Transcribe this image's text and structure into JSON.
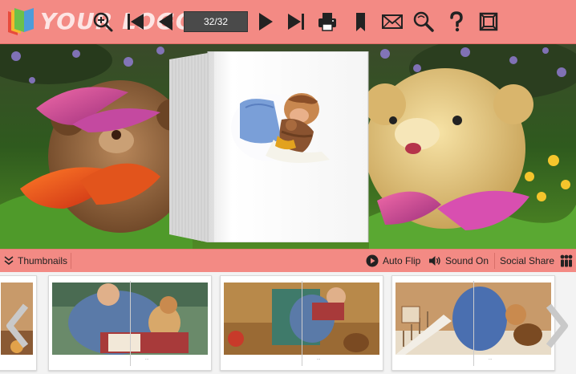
{
  "toolbar": {
    "logo_text": "YOUR LOGO",
    "page_indicator": "32/32",
    "background_color": "#f38a84",
    "buttons": [
      {
        "name": "zoom-in",
        "icon": "zoom-in-icon"
      },
      {
        "name": "first-page",
        "icon": "first-page-icon"
      },
      {
        "name": "previous-page",
        "icon": "previous-page-icon"
      },
      {
        "name": "next-page",
        "icon": "next-page-icon"
      },
      {
        "name": "last-page",
        "icon": "last-page-icon"
      },
      {
        "name": "print",
        "icon": "print-icon"
      },
      {
        "name": "bookmark",
        "icon": "bookmark-icon"
      },
      {
        "name": "email",
        "icon": "email-icon"
      },
      {
        "name": "search",
        "icon": "search-icon"
      },
      {
        "name": "help",
        "icon": "help-icon"
      },
      {
        "name": "fullscreen",
        "icon": "fullscreen-icon"
      }
    ]
  },
  "bottombar": {
    "thumbnails_label": "Thumbnails",
    "auto_flip_label": "Auto Flip",
    "sound_label": "Sound On",
    "social_share_label": "Social Share"
  },
  "thumbnails": {
    "pages": [
      {
        "caption": "..."
      },
      {
        "caption": "..."
      },
      {
        "caption": "..."
      }
    ]
  }
}
